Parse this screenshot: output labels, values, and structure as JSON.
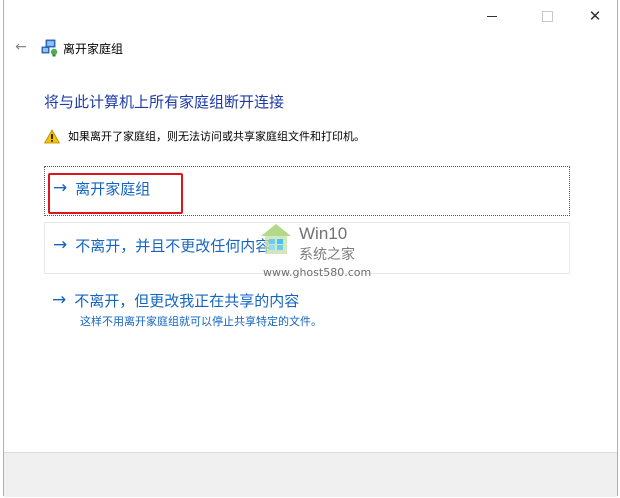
{
  "window": {
    "title": "离开家庭组",
    "controls": {
      "minimize": "minimize",
      "maximize": "maximize",
      "close": "✕"
    },
    "back": "←"
  },
  "main": {
    "heading": "将与此计算机上所有家庭组断开连接",
    "warning": "如果离开了家庭组，则无法访问或共享家庭组文件和打印机。"
  },
  "options": [
    {
      "arrow": "→",
      "label": "离开家庭组",
      "sub": ""
    },
    {
      "arrow": "→",
      "label": "不离开，并且不更改任何内容",
      "sub": ""
    },
    {
      "arrow": "→",
      "label": "不离开，但更改我正在共享的内容",
      "sub": "这样不用离开家庭组就可以停止共享特定的文件。"
    }
  ],
  "watermark": {
    "title": "Win10",
    "subtitle": "系统之家",
    "url": "www.ghost580.com"
  },
  "colors": {
    "accent": "#1565c0",
    "heading": "#1e3aa8",
    "highlight": "#e0141e",
    "warning": "#f5c400"
  }
}
